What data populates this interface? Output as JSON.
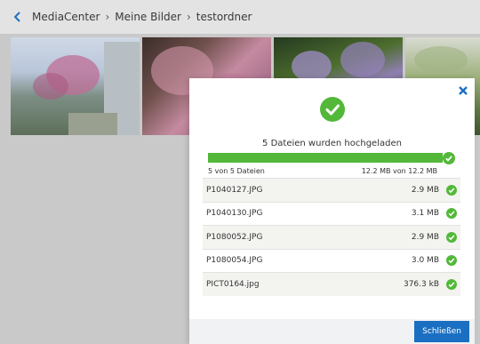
{
  "breadcrumb": {
    "items": [
      "MediaCenter",
      "Meine Bilder",
      "testordner"
    ],
    "separator": "›"
  },
  "thumbnails": [
    "photo-courtyard-blossom-tree",
    "photo-blossom-branches",
    "photo-lilac-bush",
    "photo-garden-green"
  ],
  "upload_dialog": {
    "title": "5 Dateien wurden hochgeladen",
    "progress": 1.0,
    "count_text": "5 von 5 Dateien",
    "size_text": "12.2 MB von 12.2 MB",
    "files": [
      {
        "name": "P1040127.JPG",
        "size": "2.9 MB"
      },
      {
        "name": "P1040130.JPG",
        "size": "3.1 MB"
      },
      {
        "name": "P1080052.JPG",
        "size": "2.9 MB"
      },
      {
        "name": "P1080054.JPG",
        "size": "3.0 MB"
      },
      {
        "name": "PICT0164.jpg",
        "size": "376.3 kB"
      }
    ],
    "close_button": "Schließen"
  },
  "colors": {
    "accent": "#1b6fc2",
    "success": "#53b83a"
  }
}
